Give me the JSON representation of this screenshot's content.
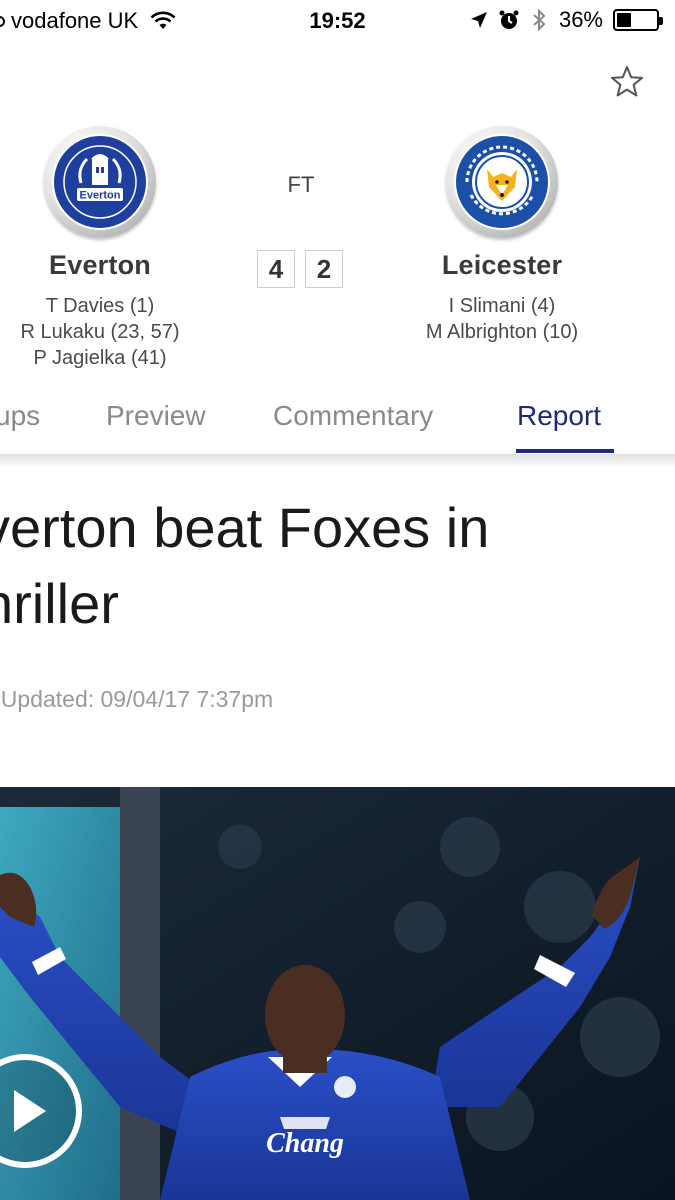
{
  "status_bar": {
    "carrier": "vodafone UK",
    "time": "19:52",
    "battery_pct": "36%",
    "battery_level": 0.36,
    "icons": [
      "signal-dot-icon",
      "wifi-icon",
      "location-arrow-icon",
      "alarm-icon",
      "bluetooth-icon",
      "battery-icon"
    ]
  },
  "match": {
    "status": "FT",
    "home": {
      "name": "Everton",
      "score": "4",
      "crest_text": "Everton",
      "scorers": [
        "T Davies (1)",
        "R Lukaku (23, 57)",
        "P Jagielka (41)"
      ]
    },
    "away": {
      "name": "Leicester",
      "score": "2",
      "scorers": [
        "I Slimani (4)",
        "M Albrighton (10)"
      ]
    }
  },
  "tabs": {
    "items": [
      "ups",
      "Preview",
      "Commentary",
      "Report"
    ],
    "active": "Report"
  },
  "article": {
    "headline_line1": "verton beat Foxes in",
    "headline_line2": "hriller",
    "updated": "t Updated: 09/04/17 7:37pm"
  },
  "hero": {
    "shirt_sponsor": "Chang",
    "icons": [
      "play-icon"
    ]
  },
  "colors": {
    "accent": "#1d2a7a",
    "everton_blue": "#1f3f9f",
    "leicester_blue": "#1b4fa8",
    "text_muted": "#8a8a8a"
  }
}
